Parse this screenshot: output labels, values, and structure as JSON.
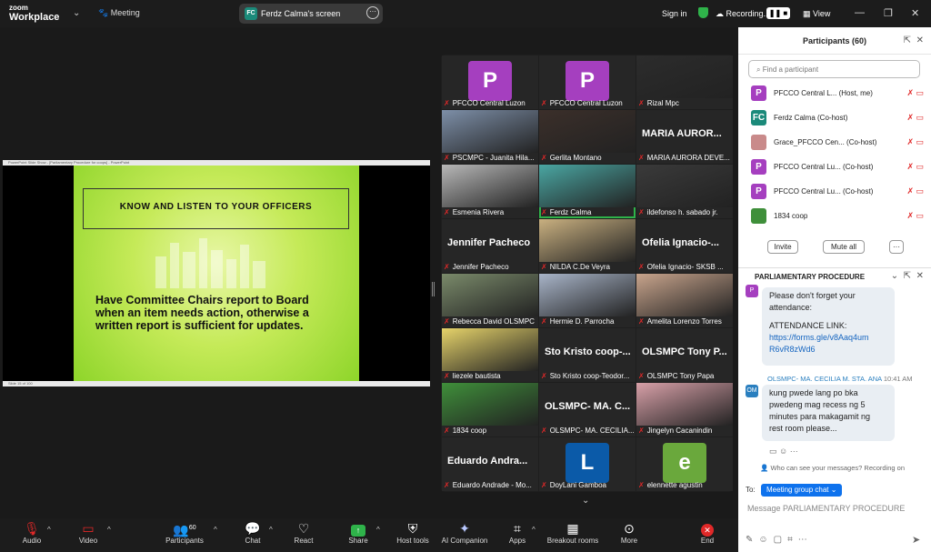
{
  "app": {
    "logo_line1": "zoom",
    "logo_line2": "Workplace",
    "meeting_label": "Meeting"
  },
  "share": {
    "banner": "Ferdz Calma's screen",
    "initials": "FC"
  },
  "topbar": {
    "signin": "Sign in",
    "recording": "Recording...",
    "view": "View"
  },
  "slide": {
    "window_title": "PowerPoint Slide Show - [Parliamentary Procedure for coops] - PowerPoint",
    "status": "Slide 15 of 100",
    "title": "KNOW AND LISTEN TO YOUR OFFICERS",
    "body": "Have Committee Chairs report to Board when an item needs action, otherwise a written report is sufficient for updates.",
    "watermark": "fotolia"
  },
  "gallery": [
    {
      "name": "PFCCO Central Luzon",
      "type": "avatar",
      "letter": "P",
      "color": "#a53fbf"
    },
    {
      "name": "PFCCO Central Luzon",
      "type": "avatar",
      "letter": "P",
      "color": "#a53fbf"
    },
    {
      "name": "Rizal Mpc",
      "type": "photo",
      "color": "#2c2c2c"
    },
    {
      "name": "PSCMPC - Juanita Hila...",
      "type": "photo",
      "color": "#7d8fa8"
    },
    {
      "name": "Gerlita Montano",
      "type": "photo",
      "color": "#3b2f2a"
    },
    {
      "name": "MARIA AURORA DEVE...",
      "type": "big",
      "big": "MARIA AUROR..."
    },
    {
      "name": "Esmenia Rivera",
      "type": "photo",
      "color": "#b8b8b8"
    },
    {
      "name": "Ferdz Calma",
      "type": "photo",
      "color": "#4aa6a2",
      "active": true
    },
    {
      "name": "ildefonso h. sabado jr.",
      "type": "photo",
      "color": "#3a3a3a"
    },
    {
      "name": "Jennifer Pacheco",
      "type": "big",
      "big": "Jennifer Pacheco"
    },
    {
      "name": "NILDA C.De Veyra",
      "type": "photo",
      "color": "#c9b080"
    },
    {
      "name": "Ofelia Ignacio- SKSB ...",
      "type": "big",
      "big": "Ofelia Ignacio-..."
    },
    {
      "name": "Rebecca David OLSMPC",
      "type": "photo",
      "color": "#7a8a6a"
    },
    {
      "name": "Hermie D. Parrocha",
      "type": "photo",
      "color": "#a8b4c8"
    },
    {
      "name": "Amelita Lorenzo Torres",
      "type": "photo",
      "color": "#c8a48c"
    },
    {
      "name": "liezele bautista",
      "type": "photo",
      "color": "#e6d36a"
    },
    {
      "name": "Sto Kristo coop-Teodor...",
      "type": "big",
      "big": "Sto Kristo coop-..."
    },
    {
      "name": "OLSMPC Tony Papa",
      "type": "big",
      "big": "OLSMPC Tony P..."
    },
    {
      "name": "1834 coop",
      "type": "photo",
      "color": "#3f8f3a"
    },
    {
      "name": "OLSMPC- MA. CECILIA...",
      "type": "big",
      "big": "OLSMPC- MA. C..."
    },
    {
      "name": "Jingelyn Cacanindin",
      "type": "photo",
      "color": "#d8a0a8"
    },
    {
      "name": "Eduardo Andrade - Mo...",
      "type": "big",
      "big": "Eduardo Andra..."
    },
    {
      "name": "DoyLani Gamboa",
      "type": "avatar",
      "letter": "L",
      "color": "#0b5aa8"
    },
    {
      "name": "elennette agustin",
      "type": "avatar",
      "letter": "e",
      "color": "#6aa83c"
    }
  ],
  "participants": {
    "title": "Participants (60)",
    "search_placeholder": "Find a participant",
    "rows": [
      {
        "name": "PFCCO Central L... (Host, me)",
        "avatar": "P",
        "color": "#a53fbf"
      },
      {
        "name": "Ferdz Calma (Co-host)",
        "avatar": "FC",
        "color": "#1b8a7a"
      },
      {
        "name": "Grace_PFCCO Cen... (Co-host)",
        "avatar": "",
        "color": "#c98a8a"
      },
      {
        "name": "PFCCO Central Lu... (Co-host)",
        "avatar": "P",
        "color": "#a53fbf"
      },
      {
        "name": "PFCCO Central Lu... (Co-host)",
        "avatar": "P",
        "color": "#a53fbf"
      },
      {
        "name": "1834 coop",
        "avatar": "",
        "color": "#3f8f3a"
      }
    ],
    "invite": "Invite",
    "mute_all": "Mute all",
    "more": "···"
  },
  "chat": {
    "title": "PARLIAMENTARY PROCEDURE",
    "msg1_line1": "Please don't forget your",
    "msg1_line2": "attendance:",
    "msg1_line3": "ATTENDANCE LINK:",
    "msg1_link1": "https://forms.gle/v8Aaq4um",
    "msg1_link2": "R6vR8zWd6",
    "sender2": "OLSMPC- MA. CECILIA M. STA. ANA",
    "time2": "10:41 AM",
    "sender2_initials": "OM",
    "msg2_line1": "kung pwede lang po bka",
    "msg2_line2": "pwedeng mag recess ng 5",
    "msg2_line3": "minutes para makagamit ng",
    "msg2_line4": "rest room please...",
    "who_can_see": "Who can see your messages? Recording on",
    "to_label": "To:",
    "to_target": "Meeting group chat",
    "message_placeholder": "Message PARLIAMENTARY PROCEDURE"
  },
  "toolbar": {
    "audio": "Audio",
    "video": "Video",
    "participants": "Participants",
    "participants_count": "60",
    "chat": "Chat",
    "react": "React",
    "share": "Share",
    "host_tools": "Host tools",
    "ai": "AI Companion",
    "apps": "Apps",
    "breakout": "Breakout rooms",
    "more": "More",
    "end": "End"
  }
}
